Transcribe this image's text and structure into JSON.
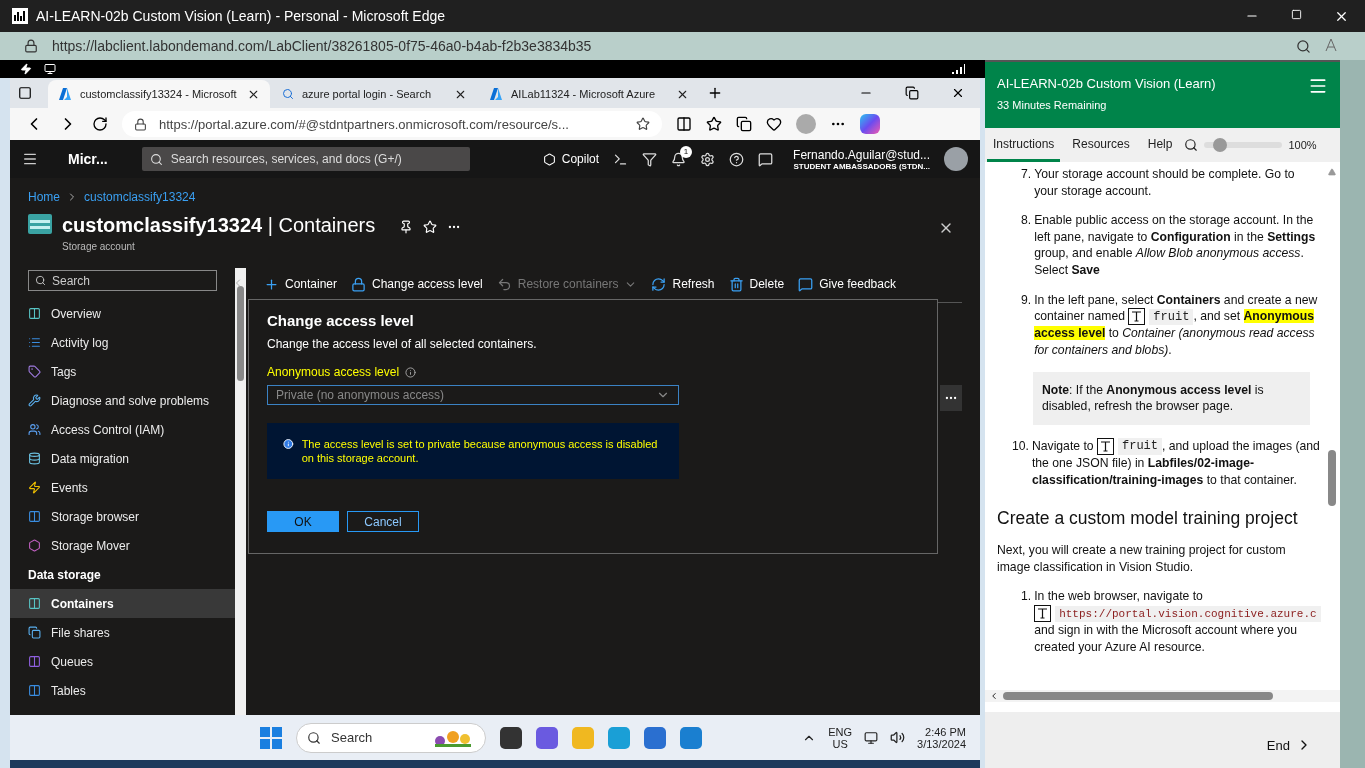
{
  "outer_window": {
    "title": "AI-LEARN-02b Custom Vision (Learn) - Personal - Microsoft Edge",
    "url": "https://labclient.labondemand.com/LabClient/38261805-0f75-46a0-b4ab-f2b3e3834b35"
  },
  "browser": {
    "tabs": [
      {
        "title": "customclassify13324 - Microsoft",
        "selected": true
      },
      {
        "title": "azure portal login - Search",
        "selected": false
      },
      {
        "title": "AILab11324 - Microsoft Azure",
        "selected": false
      }
    ],
    "url": "https://portal.azure.com/#@stdntpartners.onmicrosoft.com/resource/s..."
  },
  "portal": {
    "brand": "Micr...",
    "search_placeholder": "Search resources, services, and docs (G+/)",
    "copilot": "Copilot",
    "notification_count": "1",
    "user_name": "Fernando.Aguilar@stud...",
    "user_org": "STUDENT AMBASSADORS (STDN...",
    "breadcrumb": [
      "Home",
      "customclassify13324"
    ],
    "title": "**customclassify13324** | Containers",
    "subtitle": "Storage account",
    "sidebar": {
      "search_placeholder": "Search",
      "items": [
        {
          "label": "Overview",
          "kind": "item",
          "selected": false
        },
        {
          "label": "Activity log",
          "kind": "item",
          "selected": false
        },
        {
          "label": "Tags",
          "kind": "item",
          "selected": false
        },
        {
          "label": "Diagnose and solve problems",
          "kind": "item",
          "selected": false
        },
        {
          "label": "Access Control (IAM)",
          "kind": "item",
          "selected": false
        },
        {
          "label": "Data migration",
          "kind": "item",
          "selected": false
        },
        {
          "label": "Events",
          "kind": "item",
          "selected": false
        },
        {
          "label": "Storage browser",
          "kind": "item",
          "selected": false
        },
        {
          "label": "Storage Mover",
          "kind": "item",
          "selected": false
        }
      ],
      "groups": [
        {
          "heading": "Data storage",
          "items": [
            {
              "label": "Containers",
              "kind": "item",
              "selected": true
            },
            {
              "label": "File shares",
              "kind": "item",
              "selected": false
            },
            {
              "label": "Queues",
              "kind": "item",
              "selected": false
            },
            {
              "label": "Tables",
              "kind": "item",
              "selected": false
            }
          ]
        }
      ]
    },
    "toolbar": [
      {
        "label": "Container",
        "disabled": false
      },
      {
        "label": "Change access level",
        "disabled": false
      },
      {
        "label": "Restore containers",
        "disabled": true
      },
      {
        "label": "Refresh",
        "disabled": false
      },
      {
        "label": "Delete",
        "disabled": false
      },
      {
        "label": "Give feedback",
        "disabled": false
      }
    ],
    "dialog": {
      "title": "Change access level",
      "description": "Change the access level of all selected containers.",
      "field_label": "Anonymous access level",
      "field_value": "Private (no anonymous access)",
      "field_disabled": true,
      "info": "The access level is set to private because anonymous access is disabled on this storage account.",
      "ok": "OK",
      "cancel": "Cancel"
    }
  },
  "taskbar": {
    "search_placeholder": "Search",
    "language": "ENG",
    "region": "US",
    "time": "2:46 PM",
    "date": "3/13/2024"
  },
  "lab": {
    "title": "AI-LEARN-02b Custom Vision (Learn)",
    "remaining": "33 Minutes Remaining",
    "tabs": [
      {
        "label": "Instructions",
        "selected": true
      },
      {
        "label": "Resources",
        "selected": false
      },
      {
        "label": "Help",
        "selected": false
      }
    ],
    "zoom": {
      "level": 0.2,
      "reading": "100%"
    },
    "content": [
      {
        "kind": "step",
        "number": "7.",
        "parts": [
          {
            "kind": "text",
            "text": "Your storage account should be complete. Go to your storage account."
          }
        ]
      },
      {
        "kind": "step",
        "number": "8.",
        "parts": [
          {
            "kind": "text",
            "text": "Enable public access on the storage account. In the left pane, navigate to **Configuration** in the **Settings** group, and enable *Allow Blob anonymous access*. Select **Save**"
          }
        ]
      },
      {
        "kind": "step",
        "number": "9.",
        "parts": [
          {
            "kind": "text",
            "text": "In the left pane, select **Containers** and create a new container named "
          },
          {
            "kind": "code",
            "text": "fruit"
          },
          {
            "kind": "text",
            "text": ", and set "
          },
          {
            "kind": "highlight",
            "text": "Anonymous access level"
          },
          {
            "kind": "text",
            "text": " to *Container (anonymous read access for containers and blobs)*."
          }
        ]
      },
      {
        "kind": "note",
        "parts": [
          {
            "kind": "text",
            "text": "**Note**: If the **Anonymous access level** is disabled, refresh the browser page."
          }
        ]
      },
      {
        "kind": "step",
        "number": "10.",
        "parts": [
          {
            "kind": "text",
            "text": "Navigate to "
          },
          {
            "kind": "code",
            "text": "fruit"
          },
          {
            "kind": "text",
            "text": ", and upload the images (and the one JSON file) in **Labfiles/02-image-classification/training-images** to that container."
          }
        ]
      },
      {
        "kind": "heading",
        "text": "Create a custom model training project"
      },
      {
        "kind": "paragraph",
        "text": "Next, you will create a new training project for custom image classification in Vision Studio."
      },
      {
        "kind": "step",
        "number": "1.",
        "parts": [
          {
            "kind": "text",
            "text": "In the web browser, navigate to "
          },
          {
            "kind": "url",
            "text": "https://portal.vision.cognitive.azure.c"
          },
          {
            "kind": "text",
            "text": " and sign in with the Microsoft account where you created your Azure AI resource."
          }
        ]
      }
    ],
    "end": "End"
  }
}
